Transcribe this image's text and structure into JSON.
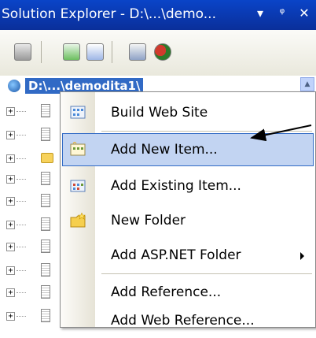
{
  "window": {
    "title": "Solution Explorer - D:\\...\\demo...",
    "buttons": [
      "▾",
      "ᵠ",
      "✕"
    ]
  },
  "tree": {
    "root_label": "D:\\...\\demodita1\\"
  },
  "menu": {
    "items": [
      {
        "label": "Build Web Site",
        "icon": "build-web-site-icon"
      },
      {
        "label": "Add New Item...",
        "icon": "add-new-item-icon"
      },
      {
        "label": "Add Existing Item...",
        "icon": "add-existing-item-icon"
      },
      {
        "label": "New Folder",
        "icon": "new-folder-icon"
      },
      {
        "label": "Add ASP.NET Folder",
        "icon": ""
      },
      {
        "label": "Add Reference...",
        "icon": ""
      },
      {
        "label": "Add Web Reference...",
        "icon": ""
      }
    ]
  },
  "colors": {
    "titlebar": "#0a44c8",
    "selection": "#316ac5",
    "highlight": "#c2d4f2"
  }
}
